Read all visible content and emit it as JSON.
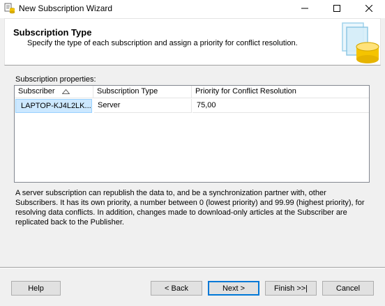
{
  "window": {
    "title": "New Subscription Wizard",
    "icon": "wizard-app-icon"
  },
  "header": {
    "title": "Subscription Type",
    "subtitle": "Specify the type of each subscription and assign a priority for conflict resolution.",
    "graphic": "database-cylinder-icon"
  },
  "properties": {
    "label": "Subscription properties:",
    "columns": [
      "Subscriber",
      "Subscription Type",
      "Priority for Conflict Resolution"
    ],
    "sort_column": "Subscriber",
    "sort_direction": "ascending",
    "rows": [
      {
        "subscriber": "LAPTOP-KJ4L2LK...",
        "type": "Server",
        "priority": "75,00"
      }
    ]
  },
  "description": "A server subscription can republish the data to, and be a synchronization partner with, other Subscribers. It has its own priority, a number between 0 (lowest priority) and 99.99 (highest priority), for resolving data conflicts. In addition, changes made to download-only articles at the Subscriber are replicated back to the Publisher.",
  "buttons": {
    "help": "Help",
    "back": "< Back",
    "next": "Next >",
    "finish": "Finish >>|",
    "cancel": "Cancel"
  },
  "colors": {
    "selection": "#cce8ff",
    "default_button_border": "#0078d7",
    "graphic_yellow": "#f5c400",
    "graphic_blue": "#9fd2ec"
  }
}
